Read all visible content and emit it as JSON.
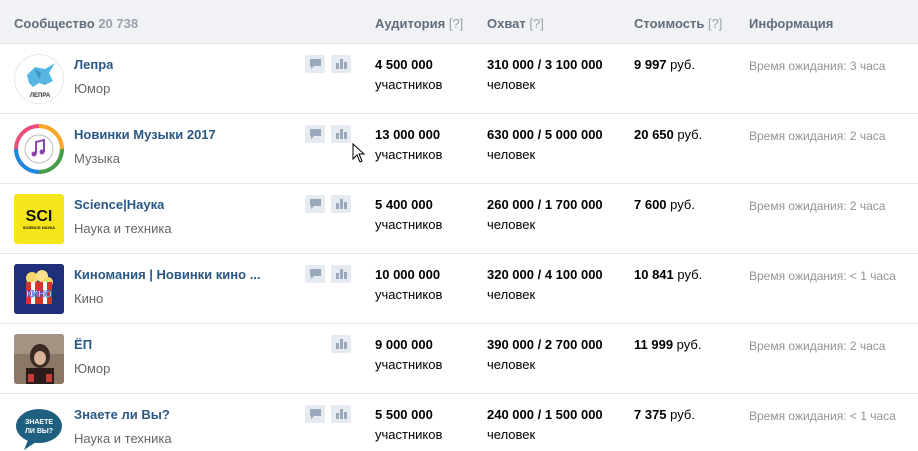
{
  "header": {
    "community_label": "Сообщество",
    "community_count": "20 738",
    "audience_label": "Аудитория",
    "reach_label": "Охват",
    "cost_label": "Стоимость",
    "info_label": "Информация",
    "help_mark": "[?]"
  },
  "rows": [
    {
      "name": "Лепра",
      "category": "Юмор",
      "audience": "4 500 000",
      "audience_unit": "участников",
      "reach": "310 000 / 3 100 000",
      "reach_unit": "человек",
      "price": "9 997",
      "currency": "руб.",
      "info": "Время ожидания: 3 часа",
      "avatar_text": "ЛЕПРА"
    },
    {
      "name": "Новинки Музыки 2017",
      "category": "Музыка",
      "audience": "13 000 000",
      "audience_unit": "участников",
      "reach": "630 000 / 5 000 000",
      "reach_unit": "человек",
      "price": "20 650",
      "currency": "руб.",
      "info": "Время ожидания: 2 часа"
    },
    {
      "name": "Science|Наука",
      "category": "Наука и техника",
      "audience": "5 400 000",
      "audience_unit": "участников",
      "reach": "260 000 / 1 700 000",
      "reach_unit": "человек",
      "price": "7 600",
      "currency": "руб.",
      "info": "Время ожидания: 2 часа",
      "avatar_text": "SCI",
      "avatar_subtext": "SCIENCE НАУКА"
    },
    {
      "name": "Киномания | Новинки кино ...",
      "category": "Кино",
      "audience": "10 000 000",
      "audience_unit": "участников",
      "reach": "320 000 / 4 100 000",
      "reach_unit": "человек",
      "price": "10 841",
      "currency": "руб.",
      "info": "Время ожидания: < 1 часа",
      "avatar_text": "КИНО"
    },
    {
      "name": "ЁП",
      "category": "Юмор",
      "audience": "9 000 000",
      "audience_unit": "участников",
      "reach": "390 000 / 2 700 000",
      "reach_unit": "человек",
      "price": "11 999",
      "currency": "руб.",
      "info": "Время ожидания: 2 часа"
    },
    {
      "name": "Знаете ли Вы?",
      "category": "Наука и техника",
      "audience": "5 500 000",
      "audience_unit": "участников",
      "reach": "240 000 / 1 500 000",
      "reach_unit": "человек",
      "price": "7 375",
      "currency": "руб.",
      "info": "Время ожидания: < 1 часа",
      "avatar_text": "ЗНАЕТЕ ЛИ ВЫ?"
    }
  ],
  "colors": {
    "header_bg": "#f0f2f5",
    "link": "#2a5885",
    "muted": "#939393",
    "icon_bg": "#e5ebf1",
    "icon_fg": "#99a8ba"
  }
}
